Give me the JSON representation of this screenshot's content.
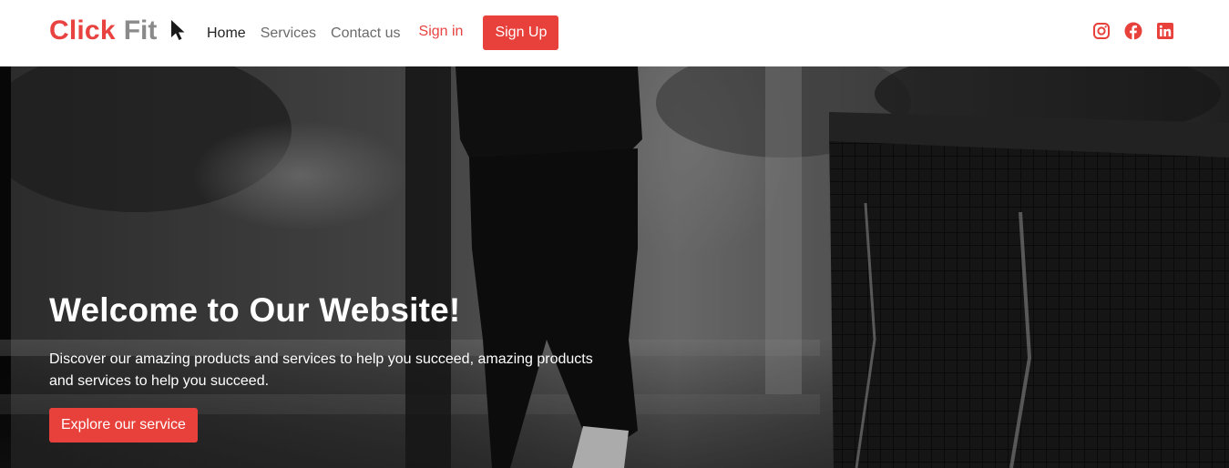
{
  "brand": {
    "part1": "Click",
    "part2": "Fit",
    "cursor_icon": "pointer-cursor-icon"
  },
  "nav": {
    "home": "Home",
    "services": "Services",
    "contact": "Contact us",
    "signin": "Sign in",
    "signup": "Sign Up"
  },
  "social": [
    "instagram-icon",
    "facebook-icon",
    "linkedin-icon"
  ],
  "hero": {
    "title": "Welcome to Our Website!",
    "text": "Discover our amazing products and services to help you succeed, amazing products and services to help you succeed.",
    "cta": "Explore our service"
  },
  "colors": {
    "accent": "#e8403a",
    "brand_grey": "#8a8a8a",
    "nav_text": "#6b6b6b"
  }
}
